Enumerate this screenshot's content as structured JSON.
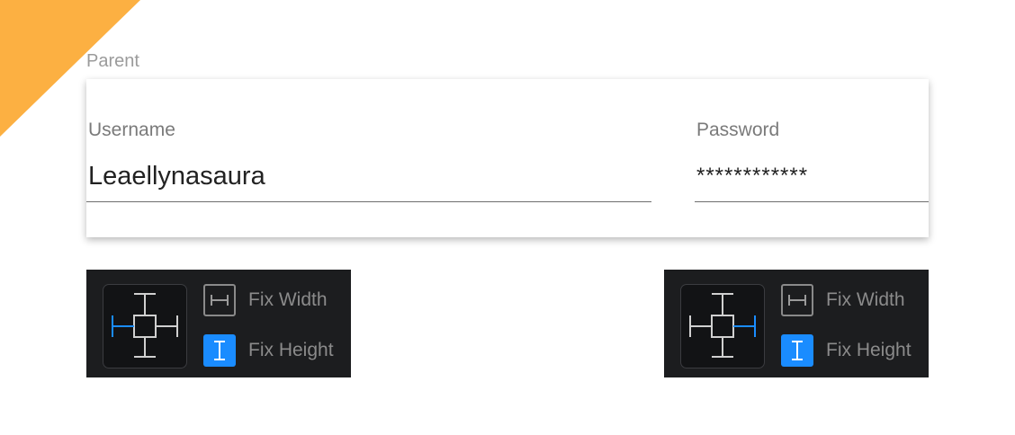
{
  "parent": {
    "label": "Parent"
  },
  "form": {
    "username": {
      "label": "Username",
      "value": "Leaellynasaura"
    },
    "password": {
      "label": "Password",
      "value": "************"
    }
  },
  "panels": [
    {
      "fix_width_label": "Fix Width",
      "fix_height_label": "Fix Height",
      "pinned_side": "left",
      "fix_height_selected": true
    },
    {
      "fix_width_label": "Fix Width",
      "fix_height_label": "Fix Height",
      "pinned_side": "right",
      "fix_height_selected": true
    }
  ],
  "colors": {
    "accent": "#1a8cff",
    "corner": "#fcb042",
    "panel_bg": "#1c1d1f"
  }
}
